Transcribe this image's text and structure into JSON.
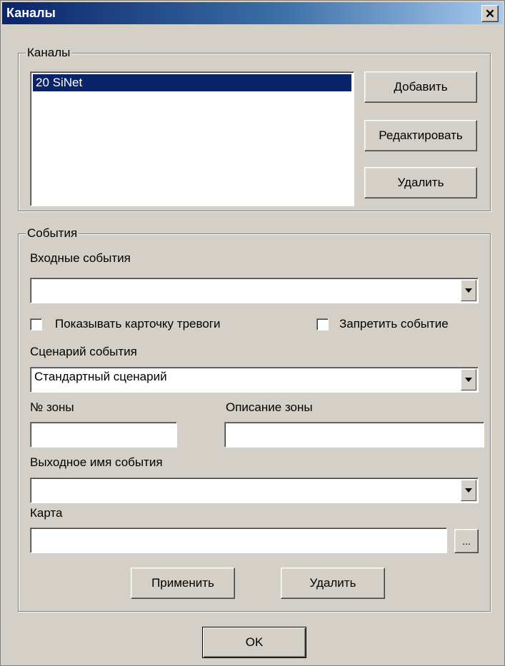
{
  "window": {
    "title": "Каналы",
    "close_glyph": "✕"
  },
  "channels_group": {
    "legend": "Каналы",
    "list_items": [
      "20  SiNet"
    ],
    "add_button": "Добавить",
    "edit_button": "Редактировать",
    "delete_button": "Удалить"
  },
  "events_group": {
    "legend": "События",
    "input_events_label": "Входные события",
    "input_events_value": "",
    "show_alarm_card_label": "Показывать карточку тревоги",
    "show_alarm_card_checked": false,
    "forbid_event_label": "Запретить событие",
    "forbid_event_checked": false,
    "scenario_label": "Сценарий события",
    "scenario_value": "Стандартный сценарий",
    "zone_number_label": "№ зоны",
    "zone_number_value": "",
    "zone_description_label": "Описание зоны",
    "zone_description_value": "",
    "output_name_label": "Выходное имя события",
    "output_name_value": "",
    "map_label": "Карта",
    "map_value": "",
    "browse_button": "...",
    "apply_button": "Применить",
    "delete_button": "Удалить"
  },
  "ok_button": "OK"
}
